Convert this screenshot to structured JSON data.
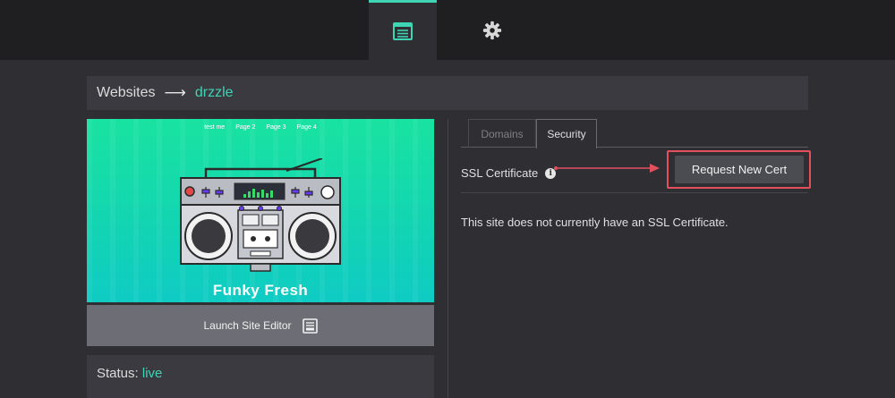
{
  "nav": {
    "items": [
      {
        "icon": "sites-list-icon",
        "active": true
      },
      {
        "icon": "gear-icon",
        "active": false
      }
    ]
  },
  "breadcrumb": {
    "root": "Websites",
    "separator": "⟶",
    "current": "drzzle"
  },
  "preview": {
    "site_nav": [
      "test me",
      "Page 2",
      "Page 3",
      "Page 4"
    ],
    "site_title": "Funky Fresh"
  },
  "launch_button": {
    "label": "Launch Site Editor",
    "icon": "editor-icon"
  },
  "status": {
    "label": "Status:",
    "value": "live"
  },
  "tabs": [
    {
      "label": "Domains",
      "active": false
    },
    {
      "label": "Security",
      "active": true
    }
  ],
  "security": {
    "ssl_label": "SSL Certificate",
    "info_icon": "info-icon",
    "request_button": "Request New Cert",
    "message": "This site does not currently have an SSL Certificate."
  },
  "colors": {
    "accent": "#3fd4b4",
    "annotation": "#e2505e",
    "background": "#2e2e33",
    "topbar": "#1f1f22"
  }
}
